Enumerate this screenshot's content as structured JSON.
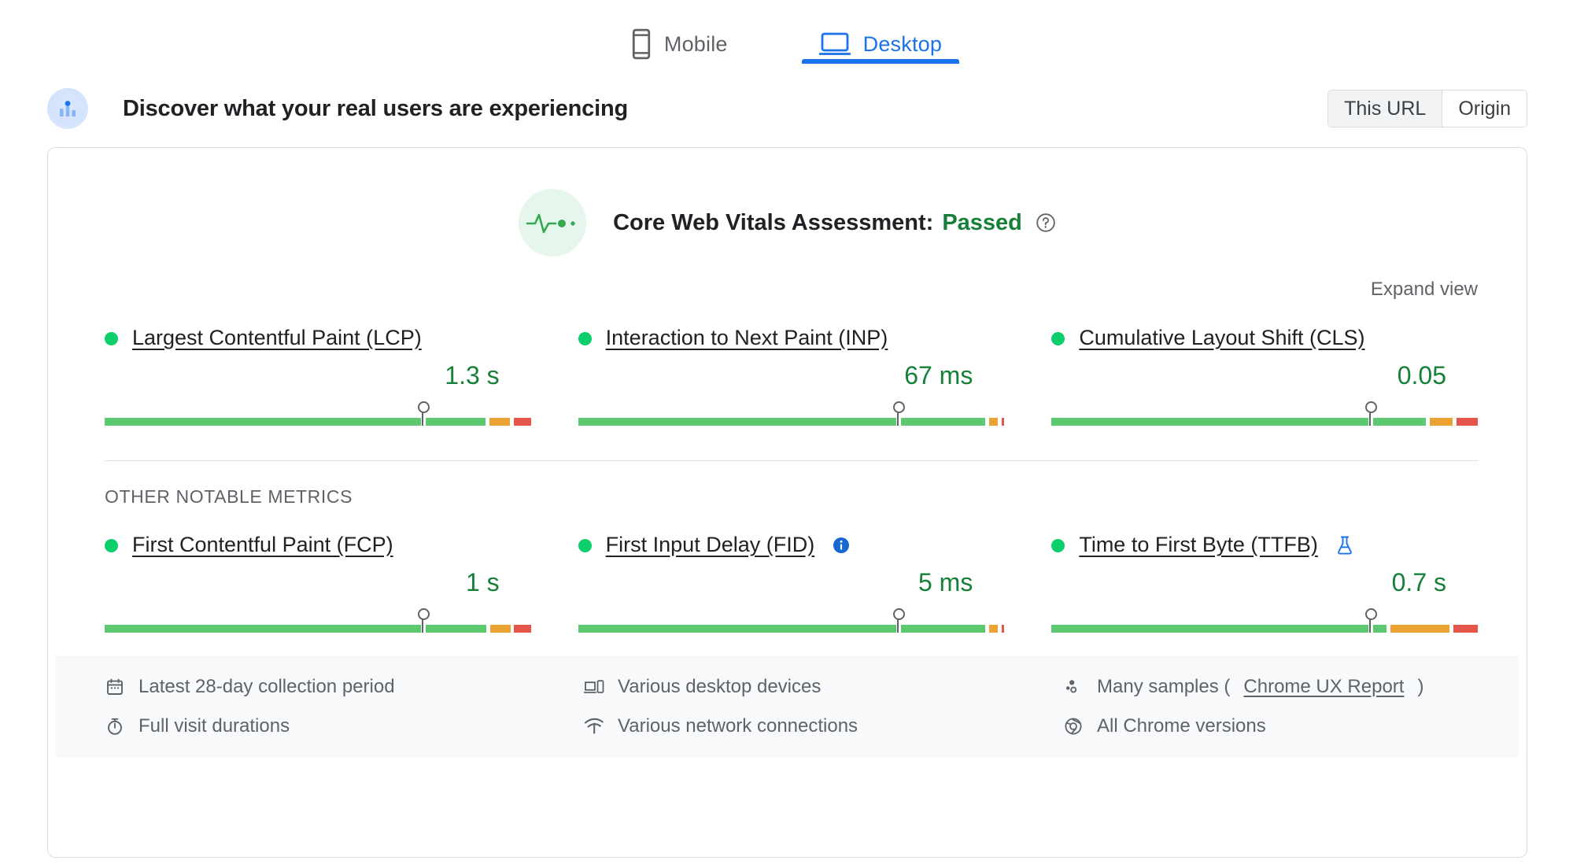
{
  "tabs": [
    {
      "label": "Mobile",
      "icon": "mobile-icon",
      "active": false
    },
    {
      "label": "Desktop",
      "icon": "desktop-icon",
      "active": true
    }
  ],
  "header": {
    "icon": "real-users-icon",
    "title": "Discover what your real users are experiencing",
    "scope_toggle": {
      "this_url": "This URL",
      "origin": "Origin",
      "selected": "This URL"
    }
  },
  "assessment": {
    "icon": "pulse-icon",
    "label": "Core Web Vitals Assessment:",
    "result": "Passed",
    "help_icon": "help-circle-icon",
    "expand_link": "Expand view"
  },
  "sections": {
    "other_metrics_label": "OTHER NOTABLE METRICS"
  },
  "colors": {
    "good": "#0cce6b",
    "good_text": "#178038",
    "bar_green": "#5cc971",
    "bar_orange": "#eba433",
    "bar_red": "#e4564a",
    "accent_blue": "#1a73e8",
    "muted": "#5f6368"
  },
  "core_web_vitals": [
    {
      "name": "Largest Contentful Paint (LCP)",
      "value": "1.3 s",
      "status": "good",
      "badge": null,
      "marker_pct": 74.5,
      "distribution": [
        {
          "color": "green",
          "pct": 74.2
        },
        {
          "color": "gap",
          "pct": 1.1
        },
        {
          "color": "green",
          "pct": 14.0
        },
        {
          "color": "gap",
          "pct": 0.9
        },
        {
          "color": "orange",
          "pct": 4.9
        },
        {
          "color": "gap",
          "pct": 0.9
        },
        {
          "color": "red",
          "pct": 4.0
        }
      ]
    },
    {
      "name": "Interaction to Next Paint (INP)",
      "value": "67 ms",
      "status": "good",
      "badge": null,
      "marker_pct": 75.0,
      "distribution": [
        {
          "color": "green",
          "pct": 74.6
        },
        {
          "color": "gap",
          "pct": 1.1
        },
        {
          "color": "green",
          "pct": 19.8
        },
        {
          "color": "gap",
          "pct": 0.9
        },
        {
          "color": "orange",
          "pct": 2.1
        },
        {
          "color": "gap",
          "pct": 0.9
        },
        {
          "color": "red",
          "pct": 0.6
        }
      ]
    },
    {
      "name": "Cumulative Layout Shift (CLS)",
      "value": "0.05",
      "status": "good",
      "badge": null,
      "marker_pct": 74.8,
      "distribution": [
        {
          "color": "green",
          "pct": 74.4
        },
        {
          "color": "gap",
          "pct": 1.1
        },
        {
          "color": "green",
          "pct": 12.4
        },
        {
          "color": "gap",
          "pct": 0.9
        },
        {
          "color": "orange",
          "pct": 5.3
        },
        {
          "color": "gap",
          "pct": 0.9
        },
        {
          "color": "red",
          "pct": 5.0
        }
      ]
    }
  ],
  "other_metrics": [
    {
      "name": "First Contentful Paint (FCP)",
      "value": "1 s",
      "status": "good",
      "badge": null,
      "marker_pct": 74.5,
      "distribution": [
        {
          "color": "green",
          "pct": 74.2
        },
        {
          "color": "gap",
          "pct": 1.1
        },
        {
          "color": "green",
          "pct": 14.2
        },
        {
          "color": "gap",
          "pct": 0.9
        },
        {
          "color": "orange",
          "pct": 4.8
        },
        {
          "color": "gap",
          "pct": 0.9
        },
        {
          "color": "red",
          "pct": 3.9
        }
      ]
    },
    {
      "name": "First Input Delay (FID)",
      "value": "5 ms",
      "status": "good",
      "badge": "info-icon",
      "marker_pct": 75.0,
      "distribution": [
        {
          "color": "green",
          "pct": 74.6
        },
        {
          "color": "gap",
          "pct": 1.1
        },
        {
          "color": "green",
          "pct": 19.9
        },
        {
          "color": "gap",
          "pct": 0.9
        },
        {
          "color": "orange",
          "pct": 1.9
        },
        {
          "color": "gap",
          "pct": 0.9
        },
        {
          "color": "red",
          "pct": 0.7
        }
      ]
    },
    {
      "name": "Time to First Byte (TTFB)",
      "value": "0.7 s",
      "status": "good",
      "badge": "flask-icon",
      "marker_pct": 74.7,
      "distribution": [
        {
          "color": "green",
          "pct": 74.3
        },
        {
          "color": "gap",
          "pct": 1.1
        },
        {
          "color": "green",
          "pct": 3.2
        },
        {
          "color": "gap",
          "pct": 0.9
        },
        {
          "color": "orange",
          "pct": 13.9
        },
        {
          "color": "gap",
          "pct": 0.9
        },
        {
          "color": "red",
          "pct": 5.7
        }
      ]
    }
  ],
  "footer": [
    [
      {
        "icon": "calendar-icon",
        "text": "Latest 28-day collection period"
      },
      {
        "icon": "stopwatch-icon",
        "text": "Full visit durations"
      }
    ],
    [
      {
        "icon": "devices-icon",
        "text": "Various desktop devices"
      },
      {
        "icon": "network-icon",
        "text": "Various network connections"
      }
    ],
    [
      {
        "icon": "samples-icon",
        "text": "Many samples (",
        "link": "Chrome UX Report",
        "text_after": ")"
      },
      {
        "icon": "chrome-icon",
        "text": "All Chrome versions"
      }
    ]
  ]
}
